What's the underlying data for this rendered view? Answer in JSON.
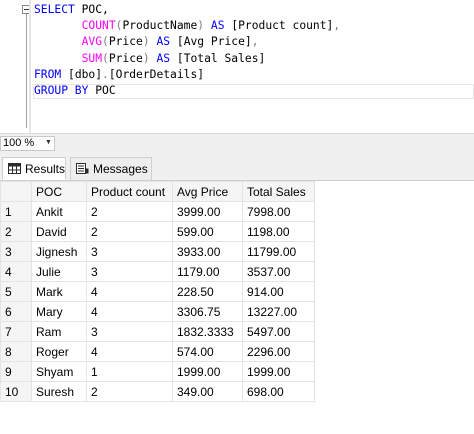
{
  "editor": {
    "line1": {
      "kw": "SELECT",
      "rest": " POC,"
    },
    "line2": {
      "fn": "COUNT",
      "open": "(",
      "arg": "ProductName",
      "close": ")",
      "as": "AS",
      "alias": "[Product count]",
      "comma": ","
    },
    "line3": {
      "fn": "AVG",
      "open": "(",
      "arg": "Price",
      "close": ")",
      "as": "AS",
      "alias": "[Avg Price]",
      "comma": ","
    },
    "line4": {
      "fn": "SUM",
      "open": "(",
      "arg": "Price",
      "close": ")",
      "as": "AS",
      "alias": "[Total Sales]"
    },
    "line5": {
      "kw": "FROM",
      "rest": " [dbo]",
      "dot": ".",
      "table": "[OrderDetails]"
    },
    "line6": {
      "kw": "GROUP BY",
      "rest": " POC"
    }
  },
  "zoom": {
    "value": "100 %"
  },
  "tabs": {
    "results": "Results",
    "messages": "Messages"
  },
  "grid": {
    "columns": [
      "POC",
      "Product count",
      "Avg Price",
      "Total Sales"
    ],
    "rows": [
      {
        "num": "1",
        "poc": "Ankit",
        "count": "2",
        "avg": "3999.00",
        "total": "7998.00"
      },
      {
        "num": "2",
        "poc": "David",
        "count": "2",
        "avg": "599.00",
        "total": "1198.00"
      },
      {
        "num": "3",
        "poc": "Jignesh",
        "count": "3",
        "avg": "3933.00",
        "total": "11799.00"
      },
      {
        "num": "4",
        "poc": "Julie",
        "count": "3",
        "avg": "1179.00",
        "total": "3537.00"
      },
      {
        "num": "5",
        "poc": "Mark",
        "count": "4",
        "avg": "228.50",
        "total": "914.00"
      },
      {
        "num": "6",
        "poc": "Mary",
        "count": "4",
        "avg": "3306.75",
        "total": "13227.00"
      },
      {
        "num": "7",
        "poc": "Ram",
        "count": "3",
        "avg": "1832.3333",
        "total": "5497.00"
      },
      {
        "num": "8",
        "poc": "Roger",
        "count": "4",
        "avg": "574.00",
        "total": "2296.00"
      },
      {
        "num": "9",
        "poc": "Shyam",
        "count": "1",
        "avg": "1999.00",
        "total": "1999.00"
      },
      {
        "num": "10",
        "poc": "Suresh",
        "count": "2",
        "avg": "349.00",
        "total": "698.00"
      }
    ]
  },
  "colors": {
    "keyword": "#0000ff",
    "function": "#ff00ff",
    "operator": "#808080",
    "panel": "#f0f0f0"
  }
}
